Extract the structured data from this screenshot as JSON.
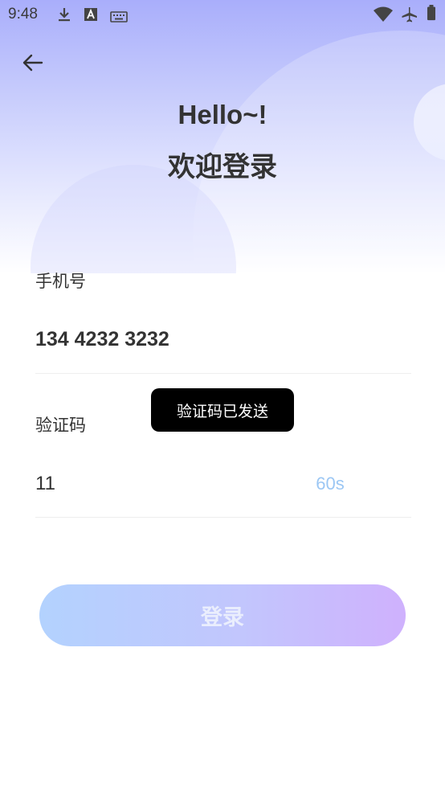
{
  "status_bar": {
    "time": "9:48",
    "icons": [
      "download-icon",
      "text-a-icon",
      "keyboard-icon",
      "wifi-icon",
      "airplane-icon",
      "battery-icon"
    ]
  },
  "hero": {
    "title": "Hello~!",
    "subtitle": "欢迎登录"
  },
  "phone": {
    "label": "手机号",
    "value": "134 4232 3232"
  },
  "code": {
    "label": "验证码",
    "value": "11",
    "countdown": "60s"
  },
  "toast": {
    "text": "验证码已发送"
  },
  "login_button": {
    "label": "登录"
  },
  "colors": {
    "accent_blue": "#9cc7f4",
    "button_start": "#b3d2fe",
    "button_end": "#cfb1fd",
    "hero_top": "#a9aefb",
    "text": "#333333"
  }
}
